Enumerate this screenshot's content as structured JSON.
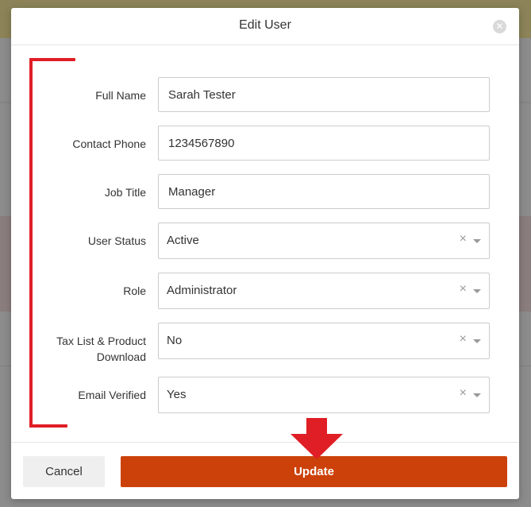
{
  "modal": {
    "title": "Edit User",
    "close_icon": "close-circle-icon"
  },
  "form": {
    "full_name": {
      "label": "Full Name",
      "value": "Sarah Tester"
    },
    "contact_phone": {
      "label": "Contact Phone",
      "value": "1234567890"
    },
    "job_title": {
      "label": "Job Title",
      "value": "Manager"
    },
    "user_status": {
      "label": "User Status",
      "value": "Active"
    },
    "role": {
      "label": "Role",
      "value": "Administrator"
    },
    "tax_list": {
      "label_line1": "Tax List & Product",
      "label_line2": "Download",
      "value": "No"
    },
    "email_verified": {
      "label": "Email Verified",
      "value": "Yes"
    }
  },
  "footer": {
    "cancel_label": "Cancel",
    "update_label": "Update"
  },
  "annotations": {
    "bracket_color": "#e01e25",
    "arrow_color": "#e01e25"
  },
  "colors": {
    "update_button": "#cc4109",
    "cancel_button": "#efefef"
  }
}
